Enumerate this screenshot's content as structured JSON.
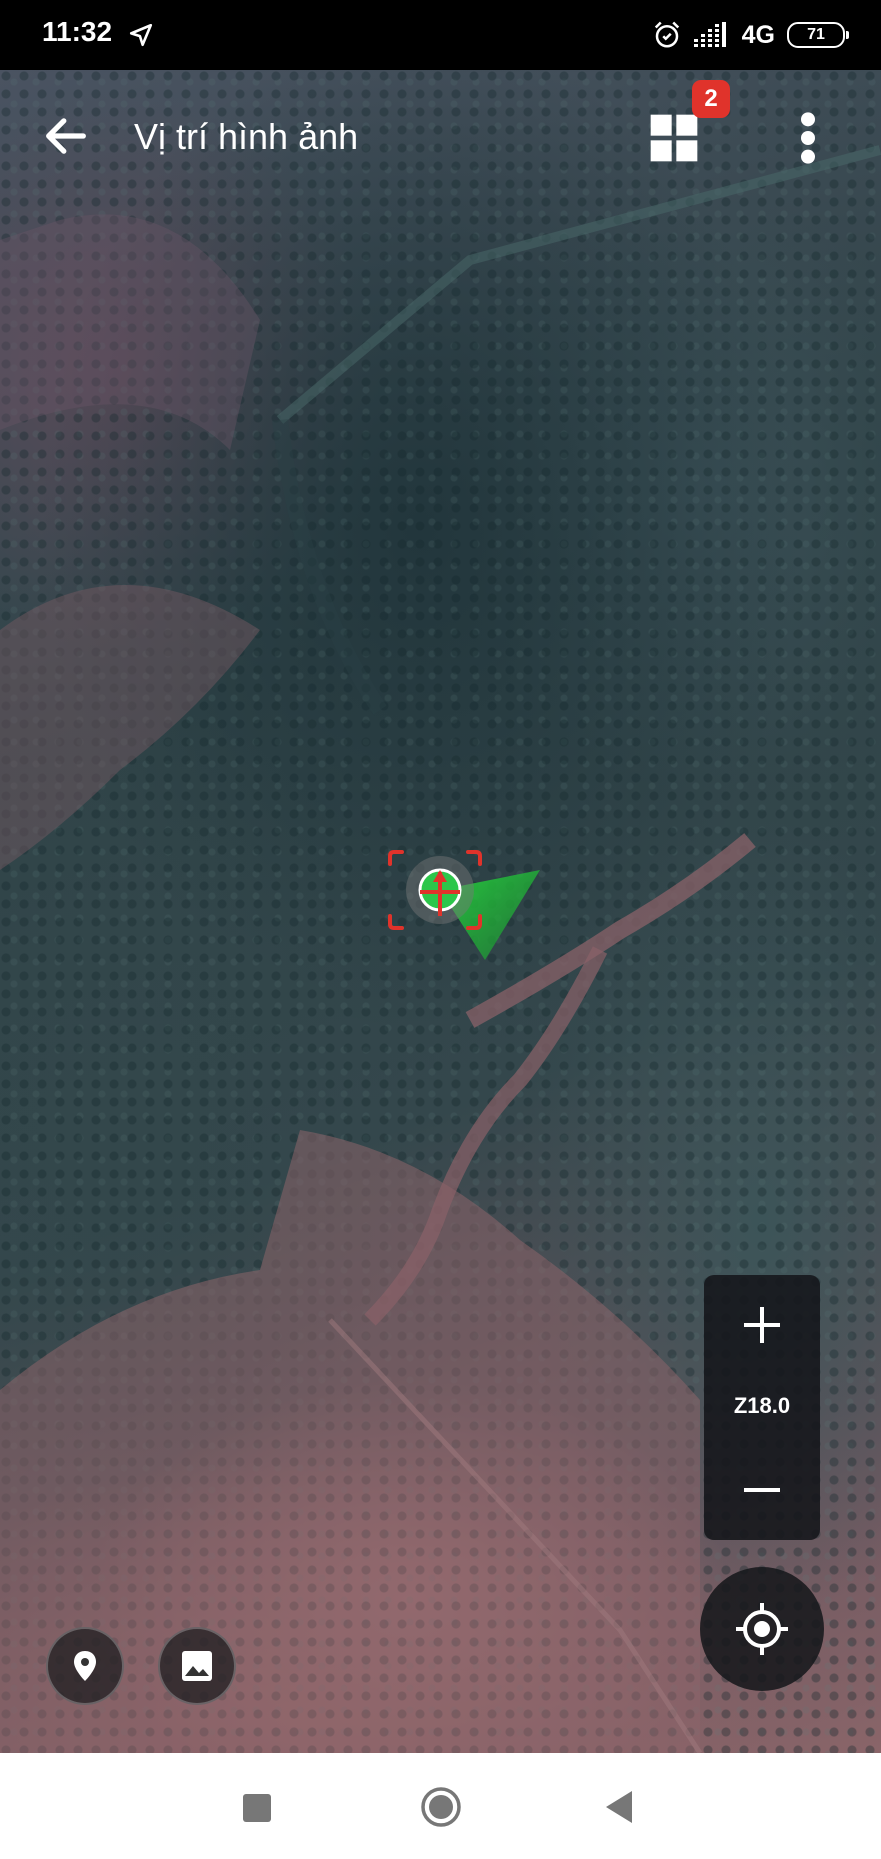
{
  "status_bar": {
    "time": "11:32",
    "network": "4G",
    "battery": "71",
    "icons": [
      "navigation-icon",
      "alarm-icon",
      "signal-icon",
      "battery-icon"
    ]
  },
  "header": {
    "title": "Vị trí hình ảnh",
    "layers_badge": "2",
    "icons": [
      "back-arrow-icon",
      "grid-icon",
      "more-vert-icon"
    ]
  },
  "map": {
    "zoom_level": "Z18.0",
    "zoom_in_icon": "plus-icon",
    "zoom_out_icon": "minus-icon",
    "locate_icon": "my-location-icon",
    "marker_icon": "photo-location-marker",
    "colors": {
      "marker_frame": "#e0332b",
      "marker_cone": "#22c43a",
      "badge": "#e0332b"
    }
  },
  "bottom_buttons": {
    "pin_icon": "location-pin-icon",
    "image_icon": "image-icon"
  },
  "navbar": {
    "icons": [
      "recents-square-icon",
      "home-circle-icon",
      "back-triangle-icon"
    ]
  }
}
